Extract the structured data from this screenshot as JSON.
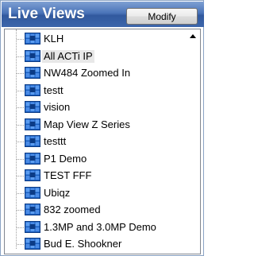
{
  "panel": {
    "title": "Live Views",
    "modify_label": "Modify"
  },
  "colors": {
    "header_top": "#7fa0d3",
    "header_bottom": "#31599e",
    "camera_icon_blue": "#1b5fbf",
    "selected_row_bg": "#e8e8e8"
  },
  "views": [
    {
      "label": "KLH",
      "icon": "camera-view-icon"
    },
    {
      "label": "All ACTi IP",
      "icon": "camera-view-icon",
      "selected": true
    },
    {
      "label": "NW484 Zoomed In",
      "icon": "camera-view-icon"
    },
    {
      "label": "testt",
      "icon": "camera-view-icon"
    },
    {
      "label": "vision",
      "icon": "camera-view-icon"
    },
    {
      "label": "Map View Z Series",
      "icon": "camera-view-icon"
    },
    {
      "label": "testtt",
      "icon": "camera-view-icon"
    },
    {
      "label": "P1 Demo",
      "icon": "camera-view-icon"
    },
    {
      "label": "TEST FFF",
      "icon": "camera-view-icon"
    },
    {
      "label": "Ubiqz",
      "icon": "camera-view-icon"
    },
    {
      "label": "832 zoomed",
      "icon": "camera-view-icon"
    },
    {
      "label": "1.3MP and 3.0MP Demo",
      "icon": "camera-view-icon"
    },
    {
      "label": "Bud E. Shookner",
      "icon": "camera-view-icon"
    }
  ],
  "scrollbar": {
    "up_icon": "scroll-up-arrow-icon"
  }
}
